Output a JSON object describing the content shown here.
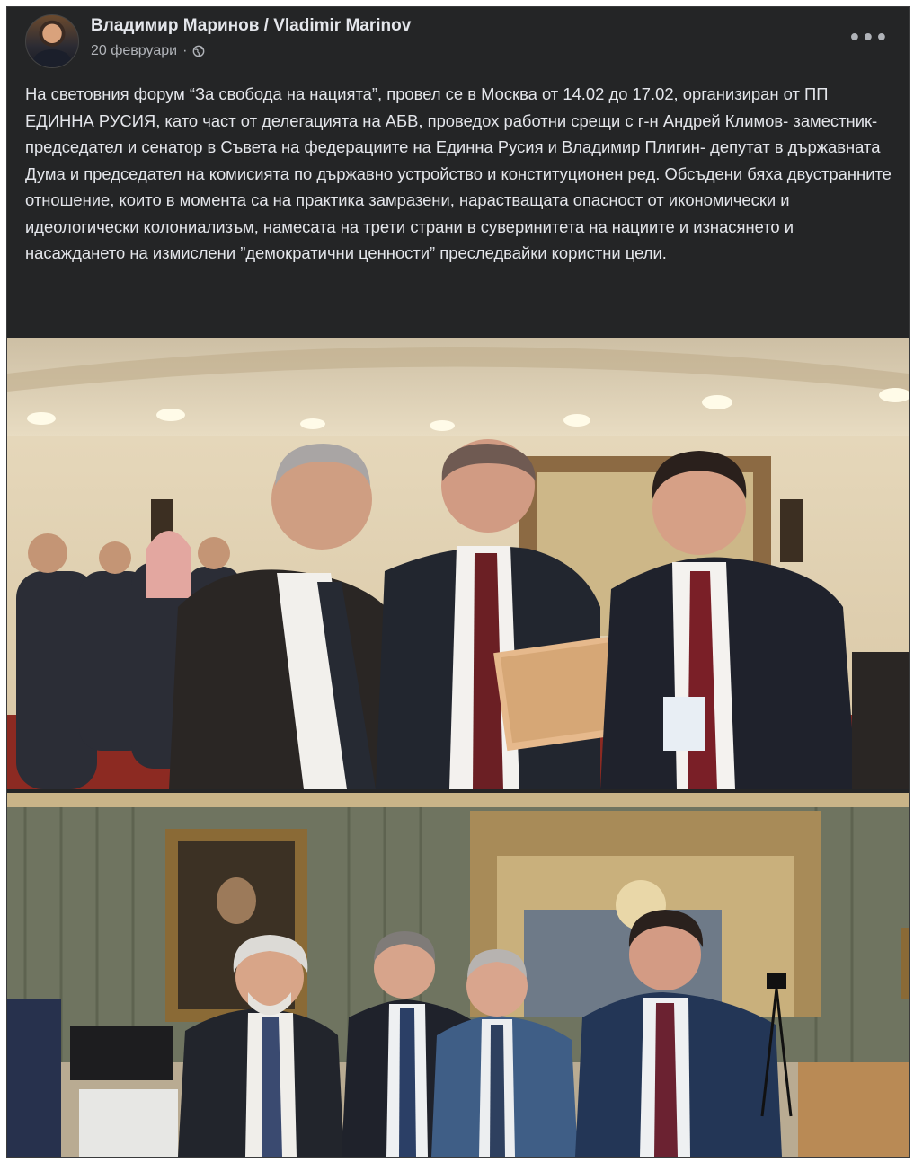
{
  "post": {
    "author": "Владимир Маринов / Vladimir Marinov",
    "date": "20 февруари",
    "separator": "·",
    "privacy_icon": "globe-icon",
    "more_label": "•••",
    "text": "На световния форум “За свобода на нацията”, провел се в Москва от 14.02 до 17.02, организиран от ПП ЕДИННА РУСИЯ, като част от делегацията на АБВ, проведох работни срещи с г-н Андрей Климов- заместник- председател и сенатор в Съвета на федерациите на Единна Русия и Владимир Плигин- депутат в държавната Дума и председател на комисията по държавно устройство и конституционен ред. Обсъдени бяха двустранните отношение, които в момента са на практика замразени, нарастващата опасност от икономически и идеологически колониализъм, намесата на трети страни в суверинитета на нациите и изнасянето и насаждането на измислени ”демократични ценности” преследвайки користни цели."
  },
  "colors": {
    "background": "#242526",
    "text": "#e4e6eb",
    "secondary_text": "#b0b3b8"
  }
}
